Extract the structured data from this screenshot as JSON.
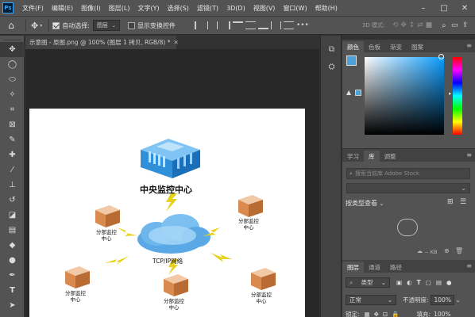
{
  "app": {
    "logo": "Ps",
    "menu": [
      "文件(F)",
      "编辑(E)",
      "图像(I)",
      "图层(L)",
      "文字(Y)",
      "选择(S)",
      "滤镜(T)",
      "3D(D)",
      "视图(V)",
      "窗口(W)",
      "帮助(H)"
    ]
  },
  "options": {
    "auto_select_label": "自动选择:",
    "auto_select_value": "图层",
    "show_transform_label": "显示变换控件",
    "mode_3d": "3D 模式:"
  },
  "document": {
    "tab_title": "示意图 - 原图.png @ 100% (图层 1 拷贝, RGB/8) *"
  },
  "diagram": {
    "center_title": "中央监控中心",
    "network_label": "TCP/IP网络",
    "branch_label_line1": "分部监控",
    "branch_label_line2": "中心"
  },
  "color_panel": {
    "tabs": [
      "颜色",
      "色板",
      "渐变",
      "图案"
    ],
    "foreground": "#4ca3d9",
    "background": "#000000"
  },
  "library_panel": {
    "tabs": [
      "学习",
      "库",
      "调整"
    ],
    "search_placeholder": "搜索当前库 Adobe Stock",
    "view_label": "按类型查看",
    "kb_label": "-- KB"
  },
  "layers_panel": {
    "tabs": [
      "图层",
      "通道",
      "路径"
    ],
    "filter_type": "类型",
    "blend_mode": "正常",
    "opacity_label": "不透明度:",
    "opacity_value": "100%",
    "lock_label": "锁定:",
    "fill_label": "填充:",
    "fill_value": "100%"
  },
  "colors": {
    "accent": "#4ca3d9",
    "building": "#2f8fd8",
    "cloud": "#5aa9e6"
  }
}
